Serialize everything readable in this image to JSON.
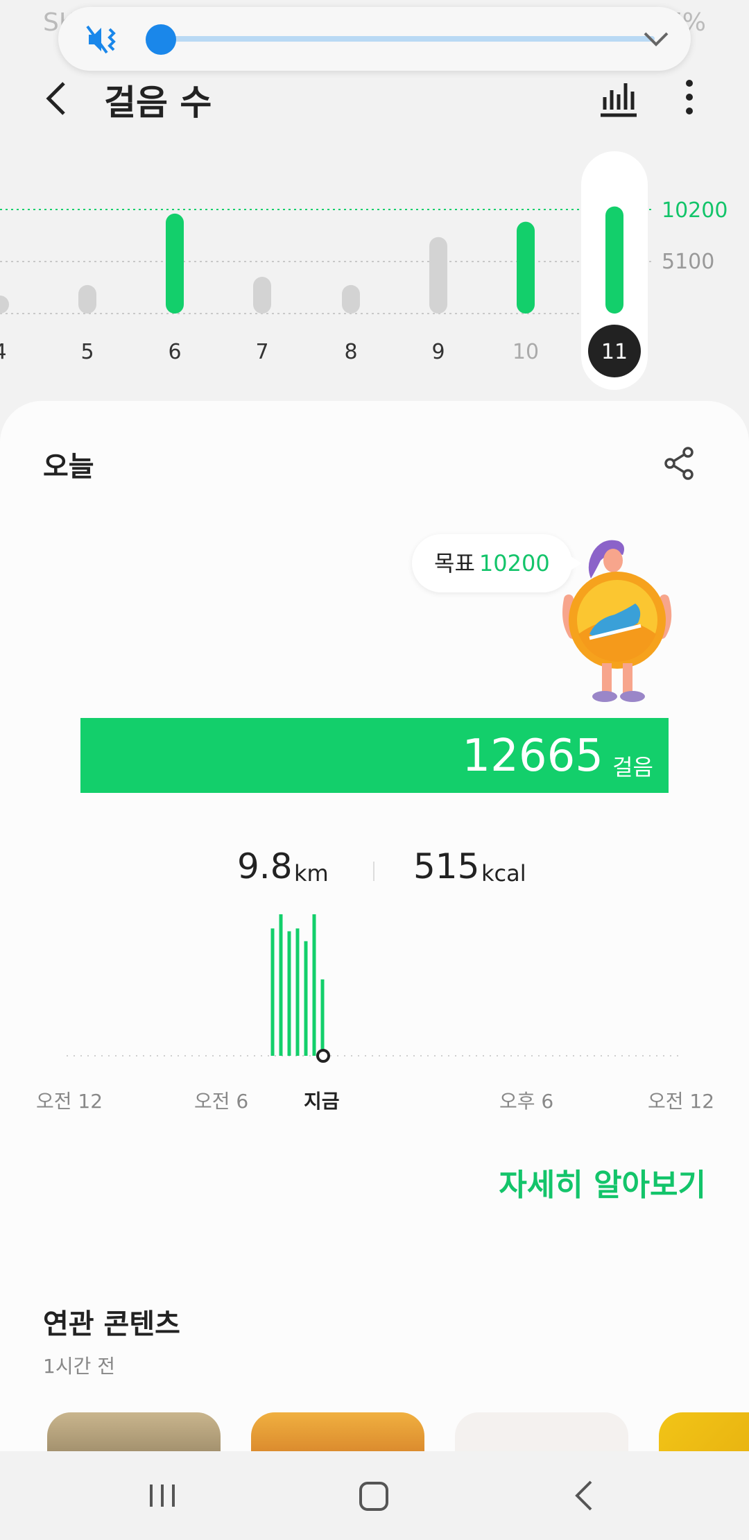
{
  "status_bar": {
    "left_text": "SK",
    "battery": "87%"
  },
  "volume": {
    "level_fraction": 0.0,
    "muted": true,
    "icon": "mute-vibrate-icon",
    "accent": "#1a87ea"
  },
  "app_bar": {
    "title": "걸음 수",
    "back_icon": "back-chevron-icon",
    "chart_icon": "bar-chart-icon",
    "more_icon": "more-vertical-icon"
  },
  "weekly_chart": {
    "goal_label": "10200",
    "half_label": "5100",
    "accent": "#13cf6b"
  },
  "chart_data": [
    {
      "type": "bar",
      "categories": [
        "4",
        "5",
        "6",
        "7",
        "8",
        "9",
        "10",
        "11"
      ],
      "values": [
        700,
        2800,
        9800,
        3600,
        2800,
        7500,
        9000,
        10500
      ],
      "goal": 10200,
      "reference_lines": [
        10200,
        5100
      ],
      "selected": "11"
    },
    {
      "type": "bar",
      "x_labels": [
        "오전 12",
        "오전 6",
        "지금",
        "오후 6",
        "오전 12"
      ],
      "values": [
        100,
        90,
        95,
        75,
        100,
        50
      ]
    }
  ],
  "today": {
    "heading": "오늘",
    "share_icon": "share-icon",
    "goal_label": "목표",
    "goal_value": "10200",
    "steps_value": "12665",
    "steps_unit": "걸음",
    "distance_value": "9.8",
    "distance_unit": "km",
    "calories_value": "515",
    "calories_unit": "kcal",
    "time_labels": {
      "midnight_am": "오전 12",
      "six_am": "오전 6",
      "now": "지금",
      "six_pm": "오후 6",
      "midnight_end": "오전 12"
    },
    "learn_more": "자세히 알아보기"
  },
  "related": {
    "title": "연관 콘텐츠",
    "time": "1시간 전"
  },
  "nav": {
    "recent_icon": "recent-apps-icon",
    "home_icon": "home-icon",
    "back_icon": "nav-back-icon"
  }
}
